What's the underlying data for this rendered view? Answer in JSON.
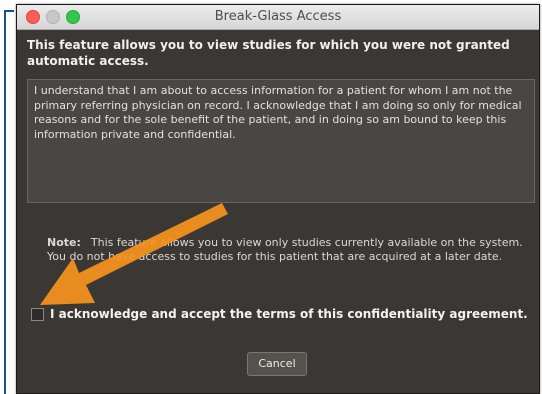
{
  "window": {
    "title": "Break-Glass Access"
  },
  "intro_text": "This feature allows you to view studies for which you were not granted automatic access.",
  "agreement_text": "I understand that I am about to access information for a patient for whom I am not the primary referring physician on record. I acknowledge that I am doing so only for medical reasons and for the sole benefit of the patient, and in doing so am bound to keep this information private and confidential.",
  "note": {
    "label": "Note:",
    "text": "This feature allows you to view only studies currently available on the system. You do not have access to studies for this patient that are acquired at a later date."
  },
  "accept_checkbox": {
    "label": "I acknowledge and accept the terms of this confidentiality agreement.",
    "checked": false
  },
  "buttons": {
    "cancel_label": "Cancel"
  },
  "annotation": {
    "arrow_color": "#f7941d"
  }
}
